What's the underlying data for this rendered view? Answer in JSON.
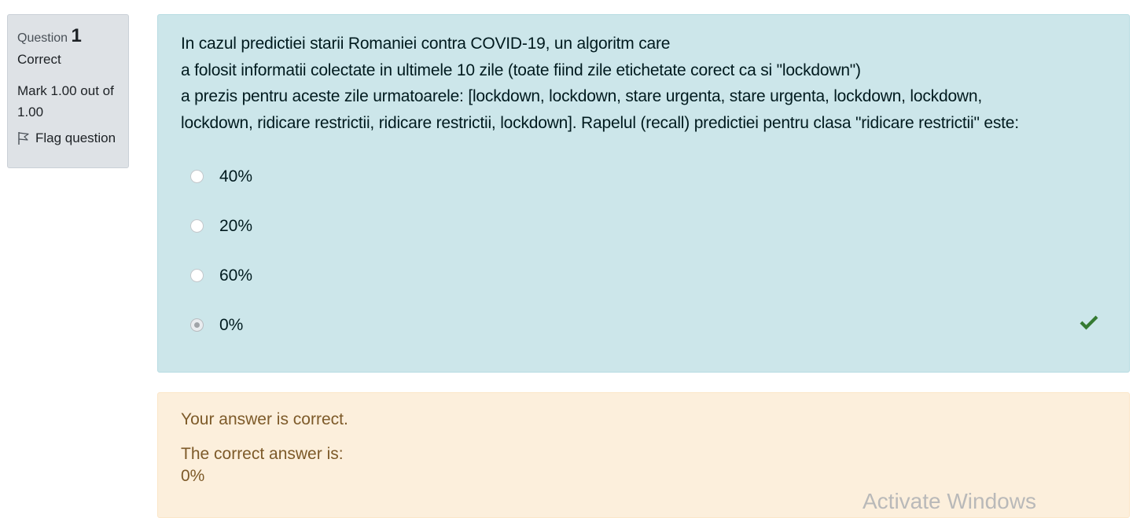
{
  "question_info": {
    "label": "Question",
    "number": "1",
    "state": "Correct",
    "grade": "Mark 1.00 out of 1.00",
    "flag_label": "Flag question"
  },
  "question": {
    "lines": [
      "In cazul predictiei starii Romaniei contra COVID-19, un algoritm care",
      "a folosit informatii colectate in ultimele 10 zile (toate fiind zile etichetate corect ca si \"lockdown\")",
      "a prezis pentru aceste zile urmatoarele: [lockdown, lockdown, stare urgenta, stare urgenta, lockdown, lockdown,",
      "lockdown, ridicare restrictii, ridicare restrictii, lockdown]. Rapelul (recall) predictiei pentru clasa \"ridicare restrictii\" este:"
    ],
    "answers": [
      {
        "label": "40%",
        "selected": false
      },
      {
        "label": "20%",
        "selected": false
      },
      {
        "label": "60%",
        "selected": false
      },
      {
        "label": "0%",
        "selected": true,
        "mark": "check-icon"
      }
    ]
  },
  "feedback": {
    "specific": "Your answer is correct.",
    "right_answer_label": "The correct answer is:",
    "right_answer_value": "0%"
  },
  "watermark": "Activate Windows",
  "colors": {
    "question_bg": "#cce6ea",
    "feedback_bg": "#fcefdc",
    "info_bg": "#dee2e6",
    "correct_icon": "#357a32"
  }
}
